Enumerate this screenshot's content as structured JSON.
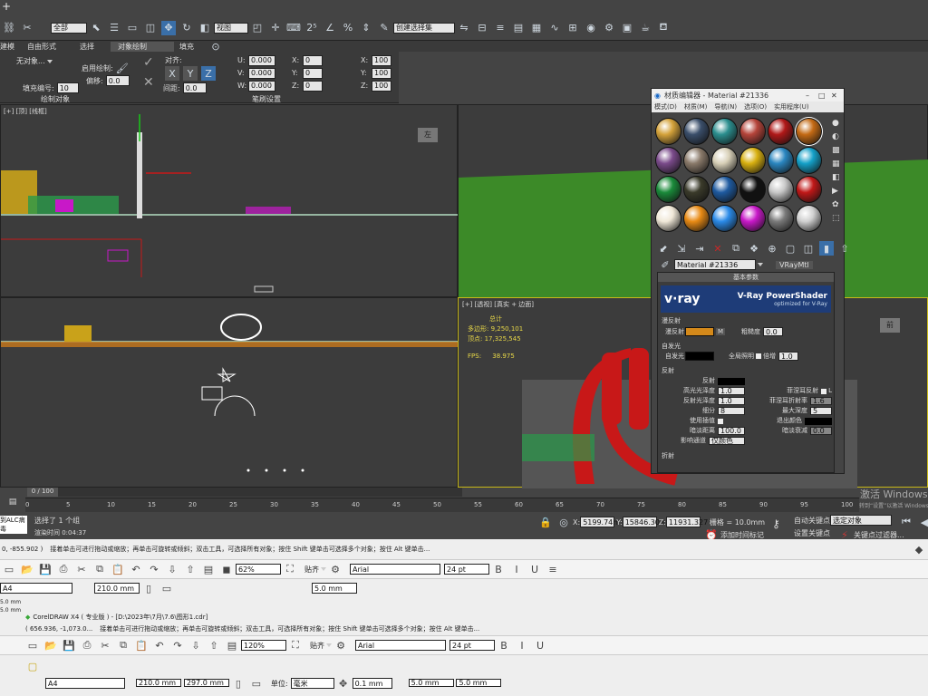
{
  "max": {
    "top_combo": "全部",
    "view_combo": "视图",
    "selection_set": "创建选择集",
    "ribbon_tabs": [
      "建模",
      "自由形式",
      "选择",
      "对象绘制",
      "填充"
    ],
    "ribbon_panel1": {
      "label": "绘制对象",
      "new_object": "无对象...",
      "fill_count_label": "填充编号:",
      "fill_count": "10",
      "enable_paint": "启用绘制:",
      "offset_label": "偏移:",
      "offset": "0.0"
    },
    "ribbon_panel2": {
      "label": "笔刷设置",
      "align": "对齐:",
      "spacing_label": "间距:",
      "spacing": "0.0",
      "u": "0.000",
      "v": "0.000",
      "w": "0.000",
      "x": "0",
      "y": "0",
      "z": "0",
      "sx": "100",
      "sy": "100",
      "sz": "100"
    },
    "vp_top_label": "[+] [顶] [线框]",
    "vp_persp_label": "[+] [透视] [真实 + 边面]",
    "stats": {
      "total": "总计",
      "polys_label": "多边形:",
      "polys": "9,250,101",
      "verts_label": "顶点:",
      "verts": "17,325,545",
      "fps_label": "FPS:",
      "fps": "38.975"
    },
    "cube_top": "左",
    "cube_persp": "前",
    "timeline": {
      "range": "0 / 100",
      "ticks": [
        "0",
        "5",
        "10",
        "15",
        "20",
        "25",
        "30",
        "35",
        "40",
        "45",
        "50",
        "55",
        "60",
        "65",
        "70",
        "75",
        "80",
        "85",
        "90",
        "95",
        "100"
      ]
    },
    "status": {
      "left": "到ALC病毒",
      "selected": "选择了 1 个组",
      "render_time": "渲染时间 0:04:37",
      "x": "5199.74m",
      "y": "15846.303",
      "z": "11931.327",
      "grid": "栅格 = 10.0mm",
      "autokey": "自动关键点",
      "selected_obj": "选定对象",
      "setkey": "设置关键点",
      "filters": "关键点过滤器...",
      "add_tag": "添加时间标记"
    },
    "watermark_win": "激活 Windows",
    "watermark_win2": "转到“设置”以激活 Windows。"
  },
  "mat": {
    "title": "材质编辑器 - Material #21336",
    "menus": [
      "模式(D)",
      "材质(M)",
      "导航(N)",
      "选项(O)",
      "实用程序(U)"
    ],
    "sphere_colors": [
      [
        "#d4a23a",
        "#3a4e6a",
        "#2b8e8e",
        "#b5443a",
        "#b01818",
        "#c46a14"
      ],
      [
        "#7a4a8a",
        "#8a7a6a",
        "#d8d0b8",
        "#d8b010",
        "#2a86c0",
        "#14a0c8"
      ],
      [
        "#1a8a3a",
        "#3a3a2a",
        "#1e5aa0",
        "#111111",
        "#c8c8c8",
        "#c01818"
      ],
      [
        "#f0e8d8",
        "#e88a14",
        "#2a8ae8",
        "#c818c8",
        "#7a7a7a",
        "#d0d0d0"
      ]
    ],
    "material_name": "Material #21336",
    "material_type": "VRayMtl",
    "rollout_basic": "基本参数",
    "vray_title": "V-Ray PowerShader",
    "vray_sub": "optimized for V-Ray",
    "vray_logo": "v·ray",
    "diffuse_section": "漫反射",
    "diffuse_label": "漫反射",
    "diffuse_color": "#d4891a",
    "roughness_label": "粗糙度",
    "roughness": "0.0",
    "self_illum_section": "自发光",
    "self_illum_label": "自发光",
    "gi_label": "全局照明",
    "multiplier_label": "倍增",
    "multiplier": "1.0",
    "reflect_section": "反射",
    "reflect_label": "反射",
    "hl_gloss_label": "高光光泽度",
    "hl_gloss": "1.0",
    "refl_gloss_label": "反射光泽度",
    "refl_gloss": "1.0",
    "subdivs_label": "细分",
    "subdivs": "8",
    "use_interp_label": "使用插值",
    "dim_dist_label": "暗淡距离",
    "dim_dist": "100.0",
    "affect_ch_label": "影响通道",
    "affect_ch": "仅颜色",
    "fresnel_label": "菲涅耳反射",
    "fresnel_ior_label": "菲涅耳折射率",
    "fresnel_ior": "1.6",
    "max_depth_label": "最大深度",
    "max_depth": "5",
    "exit_color_label": "退出颜色",
    "dim_falloff_label": "暗淡衰减",
    "dim_falloff": "0.0",
    "refract_section": "折射"
  },
  "cd1": {
    "coords": "0, -855.902 )",
    "hint": "接着单击可进行拖动或缩放；再单击可旋转或倾斜；双击工具，可选择所有对象；按住 Shift 键单击可选择多个对象；按住 Alt 键单击...",
    "zoom": "62%",
    "snap": "贴齐",
    "font": "Arial",
    "size": "24 pt",
    "paper": "A4",
    "width": "210.0 mm",
    "nudge": "5.0 mm",
    "v1": "5.0 mm",
    "v2": "5.0 mm"
  },
  "cd2": {
    "title": "CorelDRAW X4 ( 专业版 ) - [D:\\2023年\\7月\\7.6\\图形1.cdr]",
    "coords": "( 656.936, -1,073.0...",
    "hint": "接着单击可进行拖动或缩放；再单击可旋转或倾斜；双击工具，可选择所有对象；按住 Shift 键单击可选择多个对象；按住 Alt 键单击...",
    "zoom": "120%",
    "snap": "贴齐",
    "font": "Arial",
    "size": "24 pt",
    "paper": "A4",
    "width": "210.0 mm",
    "height": "297.0 mm",
    "unit_label": "单位:",
    "unit": "毫米",
    "nudge": "0.1 mm",
    "dup1": "5.0 mm",
    "dup2": "5.0 mm"
  }
}
